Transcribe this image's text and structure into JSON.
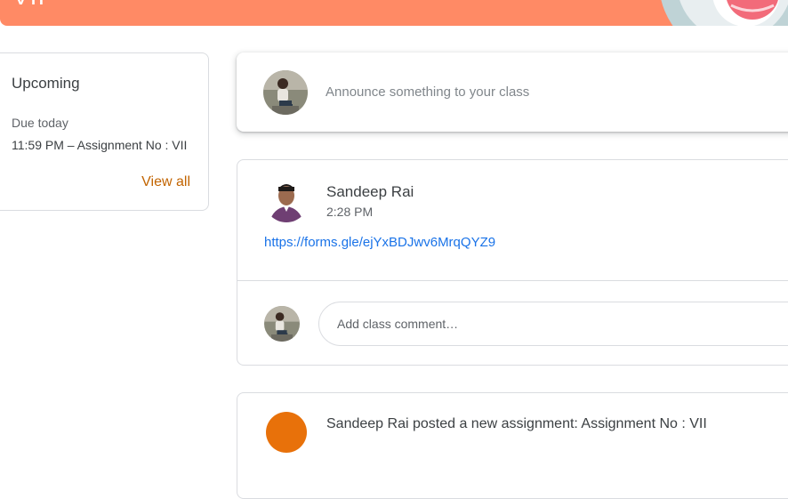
{
  "banner": {
    "title": "VII"
  },
  "upcoming": {
    "title": "Upcoming",
    "due_label": "Due today",
    "item": "11:59 PM – Assignment No : VII",
    "view_all": "View all"
  },
  "announce": {
    "placeholder": "Announce something to your class"
  },
  "post": {
    "author": "Sandeep Rai",
    "time": "2:28 PM",
    "link": "https://forms.gle/ejYxBDJwv6MrqQYZ9"
  },
  "comment": {
    "placeholder": "Add class comment…"
  },
  "assignment": {
    "title": "Sandeep Rai posted a new assignment: Assignment No : VII"
  },
  "colors": {
    "banner": "#ff8a65",
    "accent": "#c26401",
    "link": "#1a73e8",
    "assignment_icon": "#e8710a"
  }
}
